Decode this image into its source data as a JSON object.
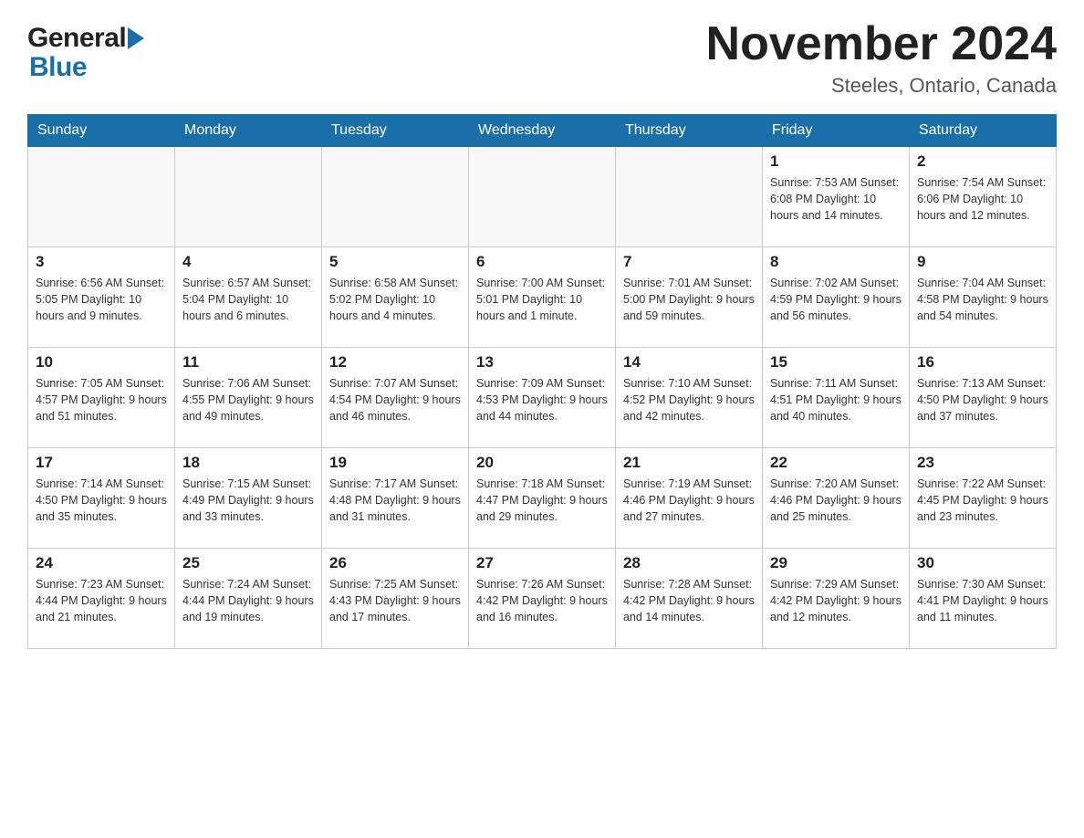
{
  "header": {
    "logo": {
      "general": "General",
      "blue": "Blue"
    },
    "title": "November 2024",
    "location": "Steeles, Ontario, Canada"
  },
  "calendar": {
    "days_of_week": [
      "Sunday",
      "Monday",
      "Tuesday",
      "Wednesday",
      "Thursday",
      "Friday",
      "Saturday"
    ],
    "weeks": [
      [
        {
          "day": "",
          "info": ""
        },
        {
          "day": "",
          "info": ""
        },
        {
          "day": "",
          "info": ""
        },
        {
          "day": "",
          "info": ""
        },
        {
          "day": "",
          "info": ""
        },
        {
          "day": "1",
          "info": "Sunrise: 7:53 AM\nSunset: 6:08 PM\nDaylight: 10 hours and 14 minutes."
        },
        {
          "day": "2",
          "info": "Sunrise: 7:54 AM\nSunset: 6:06 PM\nDaylight: 10 hours and 12 minutes."
        }
      ],
      [
        {
          "day": "3",
          "info": "Sunrise: 6:56 AM\nSunset: 5:05 PM\nDaylight: 10 hours and 9 minutes."
        },
        {
          "day": "4",
          "info": "Sunrise: 6:57 AM\nSunset: 5:04 PM\nDaylight: 10 hours and 6 minutes."
        },
        {
          "day": "5",
          "info": "Sunrise: 6:58 AM\nSunset: 5:02 PM\nDaylight: 10 hours and 4 minutes."
        },
        {
          "day": "6",
          "info": "Sunrise: 7:00 AM\nSunset: 5:01 PM\nDaylight: 10 hours and 1 minute."
        },
        {
          "day": "7",
          "info": "Sunrise: 7:01 AM\nSunset: 5:00 PM\nDaylight: 9 hours and 59 minutes."
        },
        {
          "day": "8",
          "info": "Sunrise: 7:02 AM\nSunset: 4:59 PM\nDaylight: 9 hours and 56 minutes."
        },
        {
          "day": "9",
          "info": "Sunrise: 7:04 AM\nSunset: 4:58 PM\nDaylight: 9 hours and 54 minutes."
        }
      ],
      [
        {
          "day": "10",
          "info": "Sunrise: 7:05 AM\nSunset: 4:57 PM\nDaylight: 9 hours and 51 minutes."
        },
        {
          "day": "11",
          "info": "Sunrise: 7:06 AM\nSunset: 4:55 PM\nDaylight: 9 hours and 49 minutes."
        },
        {
          "day": "12",
          "info": "Sunrise: 7:07 AM\nSunset: 4:54 PM\nDaylight: 9 hours and 46 minutes."
        },
        {
          "day": "13",
          "info": "Sunrise: 7:09 AM\nSunset: 4:53 PM\nDaylight: 9 hours and 44 minutes."
        },
        {
          "day": "14",
          "info": "Sunrise: 7:10 AM\nSunset: 4:52 PM\nDaylight: 9 hours and 42 minutes."
        },
        {
          "day": "15",
          "info": "Sunrise: 7:11 AM\nSunset: 4:51 PM\nDaylight: 9 hours and 40 minutes."
        },
        {
          "day": "16",
          "info": "Sunrise: 7:13 AM\nSunset: 4:50 PM\nDaylight: 9 hours and 37 minutes."
        }
      ],
      [
        {
          "day": "17",
          "info": "Sunrise: 7:14 AM\nSunset: 4:50 PM\nDaylight: 9 hours and 35 minutes."
        },
        {
          "day": "18",
          "info": "Sunrise: 7:15 AM\nSunset: 4:49 PM\nDaylight: 9 hours and 33 minutes."
        },
        {
          "day": "19",
          "info": "Sunrise: 7:17 AM\nSunset: 4:48 PM\nDaylight: 9 hours and 31 minutes."
        },
        {
          "day": "20",
          "info": "Sunrise: 7:18 AM\nSunset: 4:47 PM\nDaylight: 9 hours and 29 minutes."
        },
        {
          "day": "21",
          "info": "Sunrise: 7:19 AM\nSunset: 4:46 PM\nDaylight: 9 hours and 27 minutes."
        },
        {
          "day": "22",
          "info": "Sunrise: 7:20 AM\nSunset: 4:46 PM\nDaylight: 9 hours and 25 minutes."
        },
        {
          "day": "23",
          "info": "Sunrise: 7:22 AM\nSunset: 4:45 PM\nDaylight: 9 hours and 23 minutes."
        }
      ],
      [
        {
          "day": "24",
          "info": "Sunrise: 7:23 AM\nSunset: 4:44 PM\nDaylight: 9 hours and 21 minutes."
        },
        {
          "day": "25",
          "info": "Sunrise: 7:24 AM\nSunset: 4:44 PM\nDaylight: 9 hours and 19 minutes."
        },
        {
          "day": "26",
          "info": "Sunrise: 7:25 AM\nSunset: 4:43 PM\nDaylight: 9 hours and 17 minutes."
        },
        {
          "day": "27",
          "info": "Sunrise: 7:26 AM\nSunset: 4:42 PM\nDaylight: 9 hours and 16 minutes."
        },
        {
          "day": "28",
          "info": "Sunrise: 7:28 AM\nSunset: 4:42 PM\nDaylight: 9 hours and 14 minutes."
        },
        {
          "day": "29",
          "info": "Sunrise: 7:29 AM\nSunset: 4:42 PM\nDaylight: 9 hours and 12 minutes."
        },
        {
          "day": "30",
          "info": "Sunrise: 7:30 AM\nSunset: 4:41 PM\nDaylight: 9 hours and 11 minutes."
        }
      ]
    ]
  }
}
